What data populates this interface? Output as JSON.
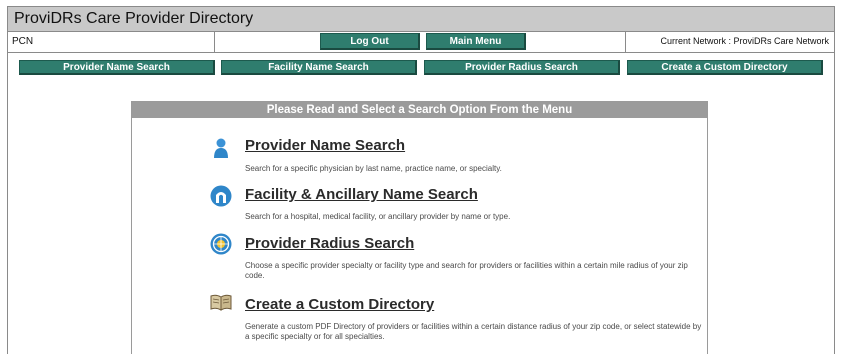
{
  "app": {
    "title": "ProviDRs Care Provider Directory"
  },
  "info_row": {
    "pcn": "PCN",
    "logout_label": "Log Out",
    "main_menu_label": "Main Menu",
    "current_network": "Current Network : ProviDRs Care Network"
  },
  "nav": {
    "provider_name": "Provider Name Search",
    "facility_name": "Facility Name Search",
    "provider_radius": "Provider Radius Search",
    "custom_directory": "Create a Custom Directory"
  },
  "panel": {
    "header": "Please Read and Select a Search Option From the Menu",
    "options": [
      {
        "title": "Provider Name Search",
        "desc": "Search for a specific physician by last name, practice name, or specialty.",
        "icon": "person-icon"
      },
      {
        "title": "Facility & Ancillary Name Search",
        "desc": "Search for a hospital, medical facility, or ancillary provider by name or type.",
        "icon": "facility-arch-icon"
      },
      {
        "title": "Provider Radius Search",
        "desc": "Choose a specific provider specialty or facility type and search for providers or facilities within a certain mile radius of your zip code.",
        "icon": "radius-globe-icon"
      },
      {
        "title": "Create a Custom Directory",
        "desc": "Generate a custom PDF Directory of providers or facilities within a certain distance radius of your zip code, or select statewide by a specific specialty or for all specialties.",
        "icon": "open-book-icon"
      }
    ]
  },
  "colors": {
    "teal": "#2f7d6e",
    "titlebar": "#c9c9c9",
    "panel_header": "#9b9b9b",
    "icon_blue": "#2f86c9"
  }
}
